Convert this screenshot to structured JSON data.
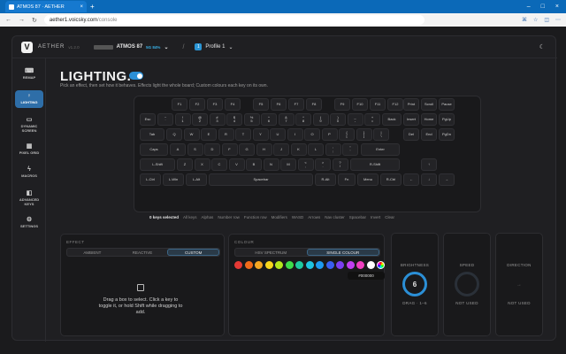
{
  "browser": {
    "tab_title": "ATMOS 87 · AETHER",
    "url_host": "aether1.voicsky.com",
    "url_path": "/console"
  },
  "header": {
    "brand": "AETHER",
    "version": "v1.2.0",
    "device_name": "ATMOS 87",
    "device_badge": "5G 84%",
    "separator": "/",
    "profile_num": "1",
    "profile_name": "Profile 1"
  },
  "sidebar": [
    {
      "label": "REMAP"
    },
    {
      "label": "LIGHTING"
    },
    {
      "label": "DYNAMIC SCREEN"
    },
    {
      "label": "PIXEL GRID"
    },
    {
      "label": "MACROS"
    },
    {
      "label": "ADVANCED KEYS"
    },
    {
      "label": "SETTINGS"
    }
  ],
  "main": {
    "title": "LIGHTING.",
    "subtitle": "Pick an effect, then set how it behaves. Effects light the whole board; Custom colours each key on its own."
  },
  "keys": {
    "row0": [
      "F1",
      "F2",
      "F3",
      "F4",
      "F5",
      "F6",
      "F7",
      "F8",
      "F9",
      "F10",
      "F11",
      "F12",
      "Print",
      "Scroll",
      "Pause"
    ],
    "esc": "Esc",
    "row1": [
      "~\n`",
      "!\n1",
      "@\n2",
      "#\n3",
      "$\n4",
      "%\n5",
      "^\n6",
      "&\n7",
      "*\n8",
      "(\n9",
      ")\n0",
      "_\n-",
      "+\n="
    ],
    "back": "Back",
    "nav1": [
      "Insert",
      "Home",
      "PgUp"
    ],
    "tab": "Tab",
    "row2": [
      "Q",
      "W",
      "E",
      "R",
      "T",
      "Y",
      "U",
      "I",
      "O",
      "P",
      "{\n[",
      "}\n]",
      "|\n\\"
    ],
    "nav2": [
      "Del",
      "End",
      "PgDn"
    ],
    "caps": "Caps",
    "row3": [
      "A",
      "S",
      "D",
      "F",
      "G",
      "H",
      "J",
      "K",
      "L",
      ":\n;",
      "\"\n'"
    ],
    "enter": "Enter",
    "lshift": "L-Shift",
    "row4": [
      "Z",
      "X",
      "C",
      "V",
      "B",
      "N",
      "M",
      "<\n,",
      ">\n.",
      "?\n/"
    ],
    "rshift": "R-Shift",
    "up": "↑",
    "row5": [
      "L-Ctrl",
      "L-Win",
      "L-Alt",
      "Spacebar",
      "R-Alt",
      "Fn",
      "Menu",
      "R-Ctrl"
    ],
    "arrows": [
      "←",
      "↓",
      "→"
    ]
  },
  "selection": {
    "count": "0 keys selected",
    "options": [
      "All keys",
      "Alphas",
      "Number row",
      "Function row",
      "Modifiers",
      "WASD",
      "Arrows",
      "Nav cluster",
      "Spacebar",
      "Invert",
      "Clear"
    ]
  },
  "effect": {
    "label": "EFFECT",
    "tabs": [
      "AMBIENT",
      "REACTIVE",
      "CUSTOM"
    ],
    "active": "CUSTOM",
    "hint": "Drag a box to select. Click a key to toggle it, or hold Shift while dragging to add."
  },
  "colour": {
    "label": "COLOUR",
    "tabs": [
      "HSV SPECTRUM",
      "SINGLE COLOUR"
    ],
    "active": "SINGLE COLOUR",
    "swatches": [
      "#e53935",
      "#f06a1a",
      "#f5a623",
      "#f7d51d",
      "#b5e61d",
      "#3ddc4a",
      "#1ec9a0",
      "#1fc4e0",
      "#1e9bf0",
      "#3a5ff0",
      "#7b3ff0",
      "#c03ff0",
      "#f03fbf",
      "#ffffff"
    ],
    "hex": "#000000"
  },
  "brightness": {
    "label": "BRIGHTNESS",
    "value": "6",
    "sub": "DRAG · 1–6",
    "color": "#2b8fd6",
    "fraction": 1.0
  },
  "speed": {
    "label": "SPEED",
    "sub": "NOT USED"
  },
  "direction": {
    "label": "DIRECTION",
    "sub": "NOT USED",
    "arrow": "→"
  }
}
